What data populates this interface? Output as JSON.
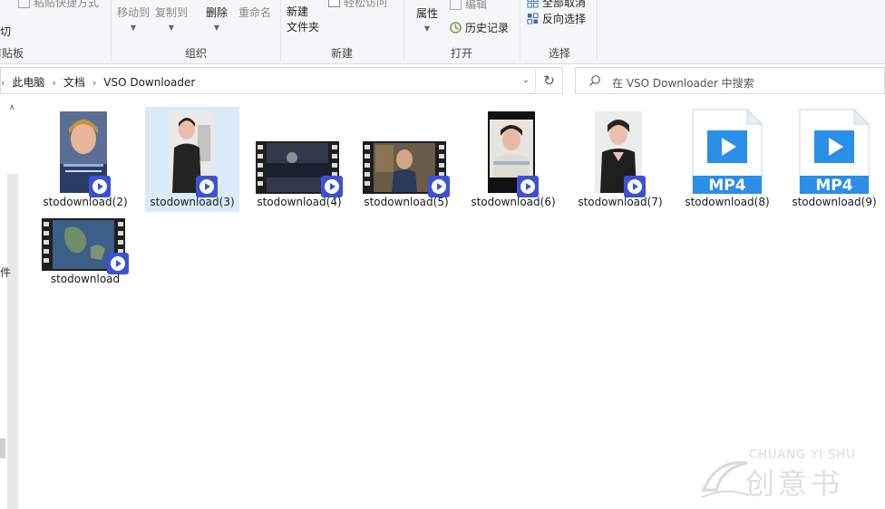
{
  "ribbon": {
    "clipboard": {
      "paste_shortcut": "粘贴快捷方式",
      "cut": "剪切",
      "group_label": "剪贴板"
    },
    "organize": {
      "move_to": "移动到",
      "copy_to": "复制到",
      "delete": "删除",
      "rename": "重命名",
      "group_label": "组织"
    },
    "new": {
      "new_folder_line1": "新建",
      "new_folder_line2": "文件夹",
      "easy_access": "轻松访问",
      "group_label": "新建"
    },
    "open": {
      "properties": "属性",
      "edit": "编辑",
      "history": "历史记录",
      "group_label": "打开"
    },
    "select": {
      "select_none": "全部取消",
      "invert_selection": "反向选择",
      "group_label": "选择"
    }
  },
  "address": {
    "crumbs": [
      "此电脑",
      "文档",
      "VSO Downloader"
    ]
  },
  "search": {
    "placeholder": "在 VSO Downloader 中搜索"
  },
  "files": [
    {
      "name": "stodownload(2)",
      "kind": "video-portrait"
    },
    {
      "name": "stodownload(3)",
      "kind": "video-portrait",
      "selected": true
    },
    {
      "name": "stodownload(4)",
      "kind": "video-film"
    },
    {
      "name": "stodownload(5)",
      "kind": "video-film"
    },
    {
      "name": "stodownload(6)",
      "kind": "video-portrait"
    },
    {
      "name": "stodownload(7)",
      "kind": "video-portrait"
    },
    {
      "name": "stodownload(8)",
      "kind": "mp4-generic",
      "label": "MP4"
    },
    {
      "name": "stodownload(9)",
      "kind": "mp4-generic",
      "label": "MP4"
    },
    {
      "name": "stodownload",
      "kind": "video-film"
    }
  ],
  "watermark": {
    "latin": "CHUANG YI SHU",
    "cn": "创意书"
  },
  "colors": {
    "accent_blue": "#3b52d6",
    "mp4_blue": "#2b8ee8",
    "selection": "#d9ebf9"
  }
}
